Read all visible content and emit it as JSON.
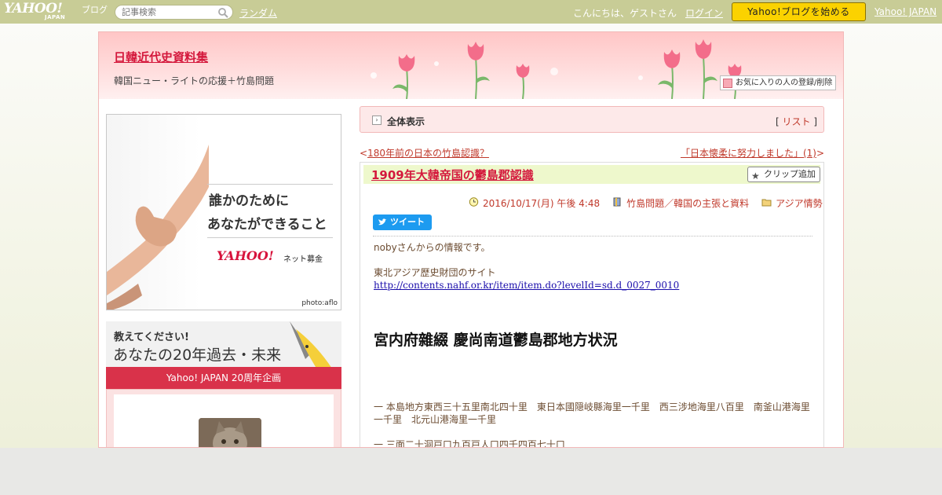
{
  "topbar": {
    "logo_text": "YAHOO!",
    "logo_sub": "JAPAN",
    "logo_blog": "ブログ",
    "search_placeholder": "記事検索",
    "random_link": "ランダム",
    "greeting": "こんにちは、ゲストさん",
    "login_link": "ログイン",
    "start_button": "Yahoo!ブログを始める",
    "yahoo_japan_link": "Yahoo! JAPAN"
  },
  "header": {
    "blog_title": "日韓近代史資料集",
    "blog_subtitle": "韓国ニュー・ライトの応援＋竹島問題",
    "favorite_button": "お気に入りの人の登録/削除"
  },
  "sidebar": {
    "ad1": {
      "line1": "誰かのために",
      "line2": "あなたができること",
      "logo": "YAHOO!",
      "service": "ネット募金",
      "credit": "photo:aflo"
    },
    "ad2": {
      "line1": "教えてください!",
      "line2": "あなたの20年過去・未来",
      "banner": "Yahoo! JAPAN 20周年企画"
    }
  },
  "view_bar": {
    "label": "全体表示",
    "list_open": "[ ",
    "list_link": "リスト",
    "list_close": " ]"
  },
  "nav": {
    "prev_arrow": "<",
    "prev_link": "180年前の日本の竹島認識？",
    "next_link": "「日本懐柔に努力しました」(1)",
    "next_arrow": ">"
  },
  "article": {
    "title": "1909年大韓帝国の鬱島郡認識",
    "clip_button": "クリップ追加",
    "date": "2016/10/17(月) 午後 4:48",
    "category": "竹島問題／韓国の主張と資料",
    "folder": "アジア情勢",
    "tweet_button": "ツイート",
    "intro": "nobyさんからの情報です。",
    "source_label": "東北アジア歴史財団のサイト",
    "source_url": "http://contents.nahf.or.kr/item/item.do?levelId=sd.d_0027_0010",
    "heading": "宮内府雜綴 慶尚南道鬱島郡地方状況",
    "para1": "一 本島地方東西三十五里南北四十里　東日本國隠岐縣海里一千里　西三涉地海里八百里　南釜山港海里一千里　北元山港海里一千里",
    "para2": "一 三面二十洞戸口九百戸人口四千四百七十口"
  },
  "colors": {
    "topbar": "#c8cc96",
    "accent_red": "#d4183c",
    "link": "#c0392b",
    "start_button": "#fbd200",
    "twitter": "#1d9bf0"
  }
}
